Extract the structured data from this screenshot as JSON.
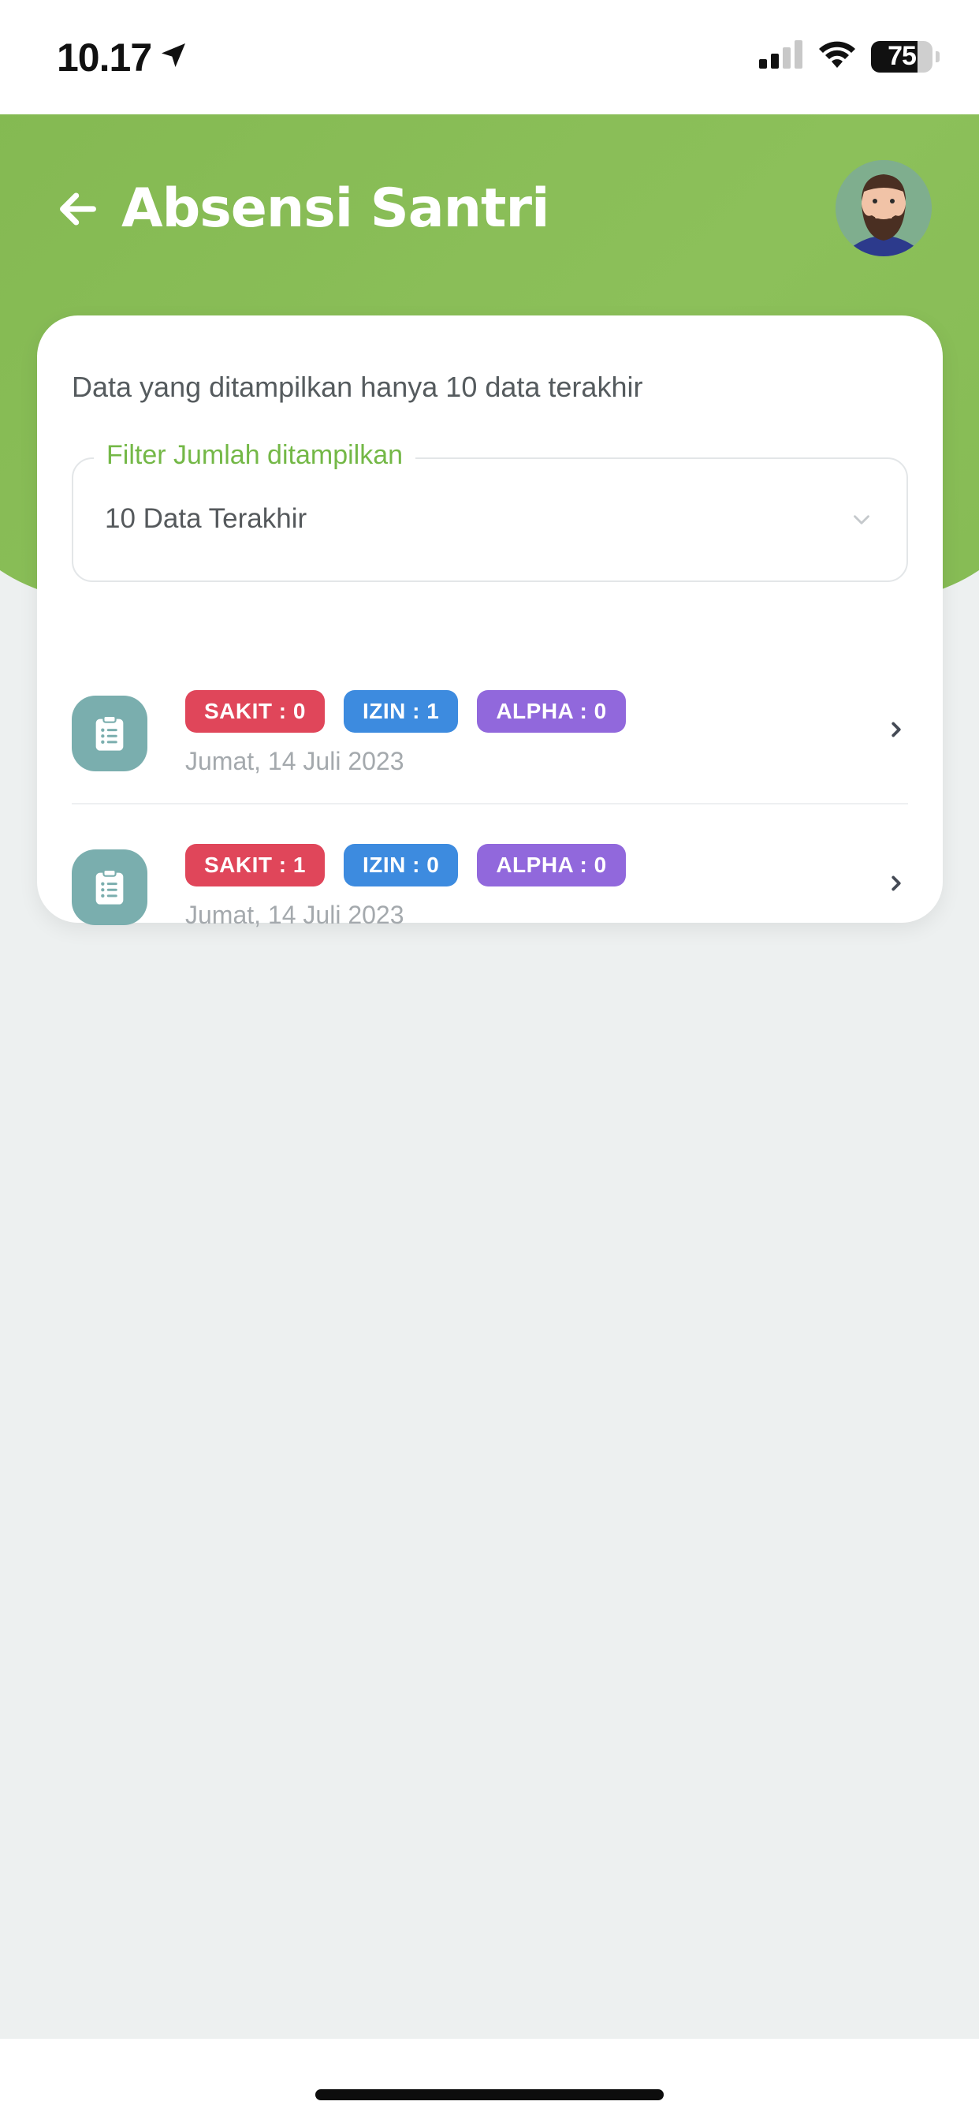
{
  "status_bar": {
    "time": "10.17",
    "battery_level": "75",
    "battery_fraction": 0.75
  },
  "header": {
    "title": "Absensi Santri",
    "back_icon": "arrow-left-icon",
    "avatar": "bearded-man-avatar"
  },
  "card": {
    "info_text": "Data yang ditampilkan hanya 10 data terakhir",
    "filter": {
      "label": "Filter Jumlah ditampilkan",
      "selected": "10 Data Terakhir"
    },
    "items": [
      {
        "sakit": "SAKIT : 0",
        "izin": "IZIN : 1",
        "alpha": "ALPHA : 0",
        "date": "Jumat, 14 Juli 2023"
      },
      {
        "sakit": "SAKIT : 1",
        "izin": "IZIN : 0",
        "alpha": "ALPHA : 0",
        "date": "Jumat, 14 Juli 2023"
      }
    ]
  },
  "colors": {
    "header_green": "#8cc05a",
    "accent_green": "#74b847",
    "sakit": "#e0465a",
    "izin": "#3d8bdf",
    "alpha": "#9168dc",
    "icon_teal": "#7aaeae",
    "background": "#edf0f0"
  }
}
